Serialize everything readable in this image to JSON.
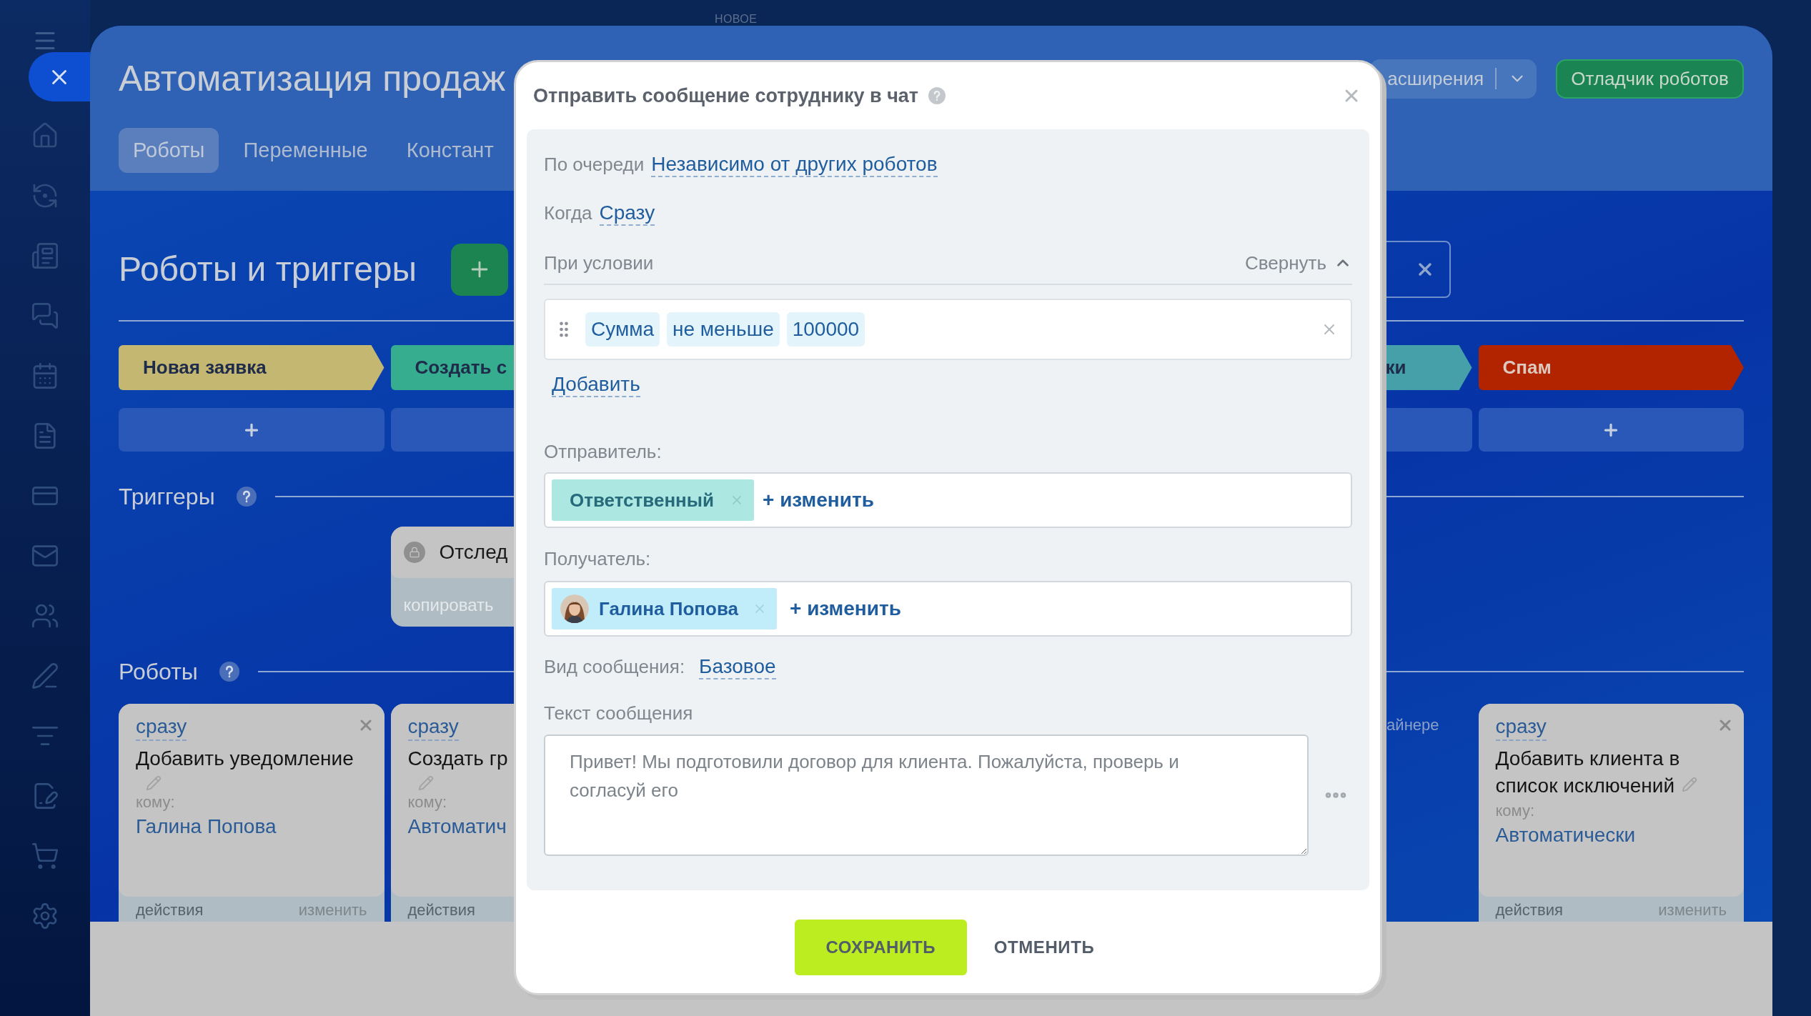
{
  "top_label": "НОВОЕ",
  "header": {
    "title": "Автоматизация продаж",
    "tabs": [
      {
        "label": "Роботы",
        "selected": true
      },
      {
        "label": "Переменные",
        "selected": false
      },
      {
        "label": "Констант",
        "selected": false
      }
    ],
    "extensions_button": "асширения",
    "debugger_button": "Отладчик роботов"
  },
  "section_title": "Роботы и триггеры",
  "stages": [
    {
      "label": "Новая заявка",
      "color": "#c3b772"
    },
    {
      "label": "Создать с",
      "color": "#36ad8f"
    },
    {
      "label": "ки",
      "color": "#46a0a9"
    },
    {
      "label": "Спам",
      "color": "#b22400"
    }
  ],
  "triggers": {
    "title": "Триггеры",
    "card": {
      "title": "Отслед",
      "footer": "копировать"
    }
  },
  "robots": {
    "title": "Роботы",
    "cards_left": [
      {
        "timing": "сразу",
        "title": "Добавить уведомление",
        "to_label": "кому:",
        "to": "Галина Попова",
        "footer_left": "действия",
        "footer_right": "изменить"
      },
      {
        "timing": "сразу",
        "title": "Создать гр",
        "to_label": "кому:",
        "to": "Автоматич",
        "footer_left": "действия"
      }
    ],
    "side_note": "айнере",
    "cards_right": [
      {
        "timing": "сразу",
        "title": "Добавить клиента в список исключений",
        "to_label": "кому:",
        "to": "Автоматически",
        "footer_left": "действия",
        "footer_right": "изменить"
      }
    ]
  },
  "dialog": {
    "title": "Отправить сообщение сотруднику в чат",
    "order_label": "По очереди",
    "order_value": "Независимо от других роботов",
    "when_label": "Когда",
    "when_value": "Сразу",
    "condition_label": "При условии",
    "collapse": "Свернуть",
    "condition": [
      "Сумма",
      "не меньше",
      "100000"
    ],
    "add": "Добавить",
    "sender_label": "Отправитель:",
    "sender": {
      "chip": "Ответственный",
      "change": "+ изменить"
    },
    "recipient_label": "Получатель:",
    "recipient": {
      "chip": "Галина Попова",
      "change": "+ изменить"
    },
    "message_type_label": "Вид сообщения:",
    "message_type": "Базовое",
    "text_label": "Текст сообщения",
    "text": "Привет! Мы подготовили договор для клиента. Пожалуйста, проверь и согласуй его",
    "save": "СОХРАНИТЬ",
    "cancel": "ОТМЕНИТЬ"
  }
}
